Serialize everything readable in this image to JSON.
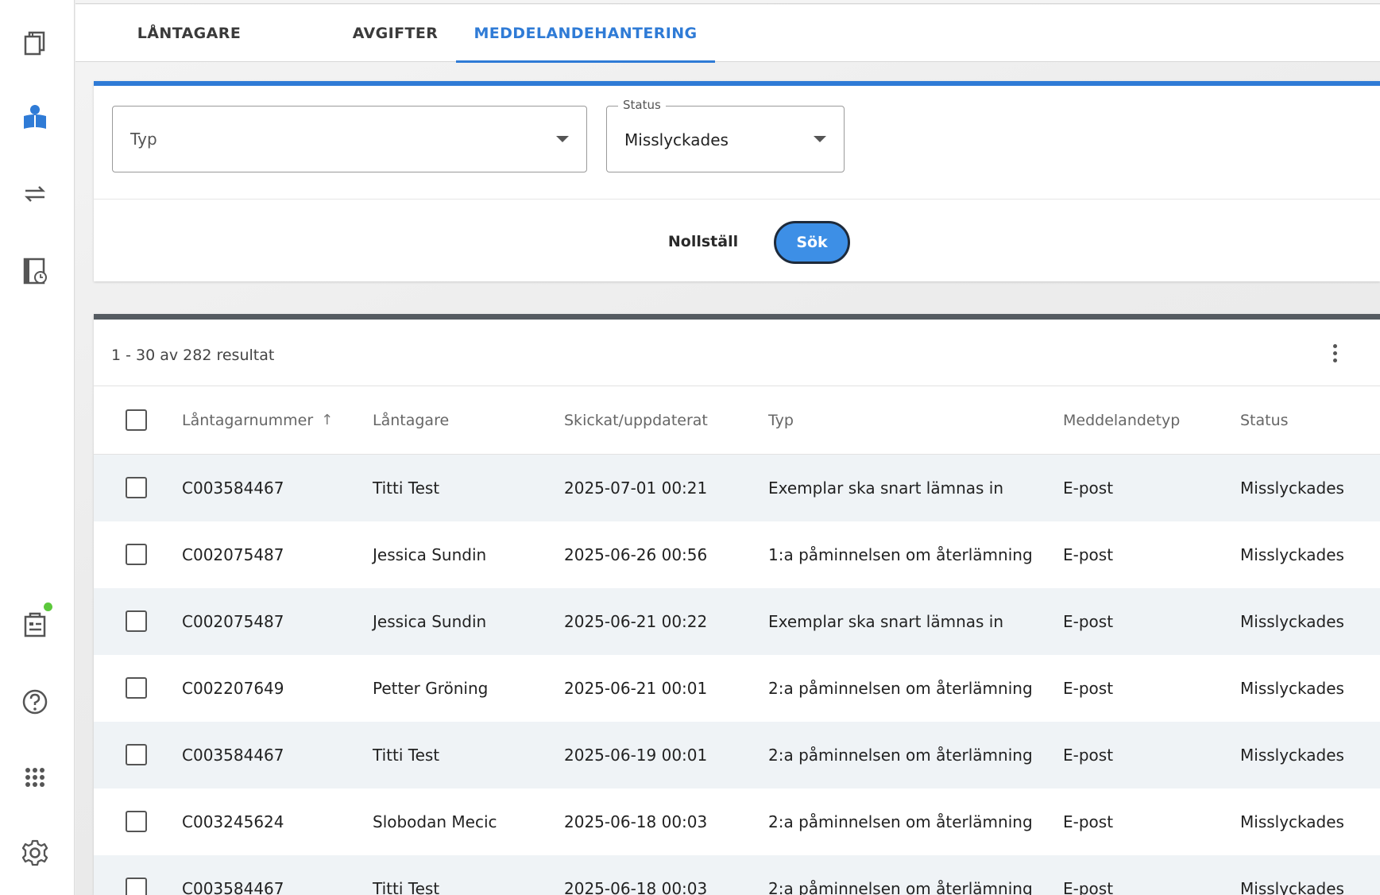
{
  "sidebar": {
    "items": [
      {
        "name": "catalog-icon",
        "label": "Katalog"
      },
      {
        "name": "borrower-icon",
        "label": "Låntagare"
      },
      {
        "name": "transfer-icon",
        "label": "Överföringar"
      },
      {
        "name": "history-icon",
        "label": "Historik"
      },
      {
        "name": "reports-icon",
        "label": "Rapporter"
      },
      {
        "name": "help-icon",
        "label": "Hjälp"
      },
      {
        "name": "apps-icon",
        "label": "Appar"
      },
      {
        "name": "settings-icon",
        "label": "Inställningar"
      }
    ],
    "notification_color": "#5cc83c"
  },
  "tabs": [
    {
      "label": "LÅNTAGARE",
      "active": false
    },
    {
      "label": "AVGIFTER",
      "active": false
    },
    {
      "label": "MEDDELANDEHANTERING",
      "active": true
    }
  ],
  "filters": {
    "type": {
      "placeholder": "Typ",
      "value": ""
    },
    "status": {
      "legend": "Status",
      "value": "Misslyckades"
    },
    "reset_label": "Nollställ",
    "search_label": "Sök"
  },
  "results": {
    "count_text": "1 - 30 av 282 resultat",
    "columns": [
      "Låntagarnummer",
      "Låntagare",
      "Skickat/uppdaterat",
      "Typ",
      "Meddelandetyp",
      "Status"
    ],
    "rows": [
      [
        "C003584467",
        "Titti Test",
        "2025-07-01 00:21",
        "Exemplar ska snart lämnas in",
        "E-post",
        "Misslyckades"
      ],
      [
        "C002075487",
        "Jessica Sundin",
        "2025-06-26 00:56",
        "1:a påminnelsen om återlämning",
        "E-post",
        "Misslyckades"
      ],
      [
        "C002075487",
        "Jessica Sundin",
        "2025-06-21 00:22",
        "Exemplar ska snart lämnas in",
        "E-post",
        "Misslyckades"
      ],
      [
        "C002207649",
        "Petter Gröning",
        "2025-06-21 00:01",
        "2:a påminnelsen om återlämning",
        "E-post",
        "Misslyckades"
      ],
      [
        "C003584467",
        "Titti Test",
        "2025-06-19 00:01",
        "2:a påminnelsen om återlämning",
        "E-post",
        "Misslyckades"
      ],
      [
        "C003245624",
        "Slobodan Mecic",
        "2025-06-18 00:03",
        "2:a påminnelsen om återlämning",
        "E-post",
        "Misslyckades"
      ],
      [
        "C003584467",
        "Titti Test",
        "2025-06-18 00:03",
        "2:a påminnelsen om återlämning",
        "E-post",
        "Misslyckades"
      ]
    ]
  },
  "colors": {
    "accent": "#2f7bd6",
    "button": "#3d8fe6",
    "row_shade": "#eff3f6"
  }
}
